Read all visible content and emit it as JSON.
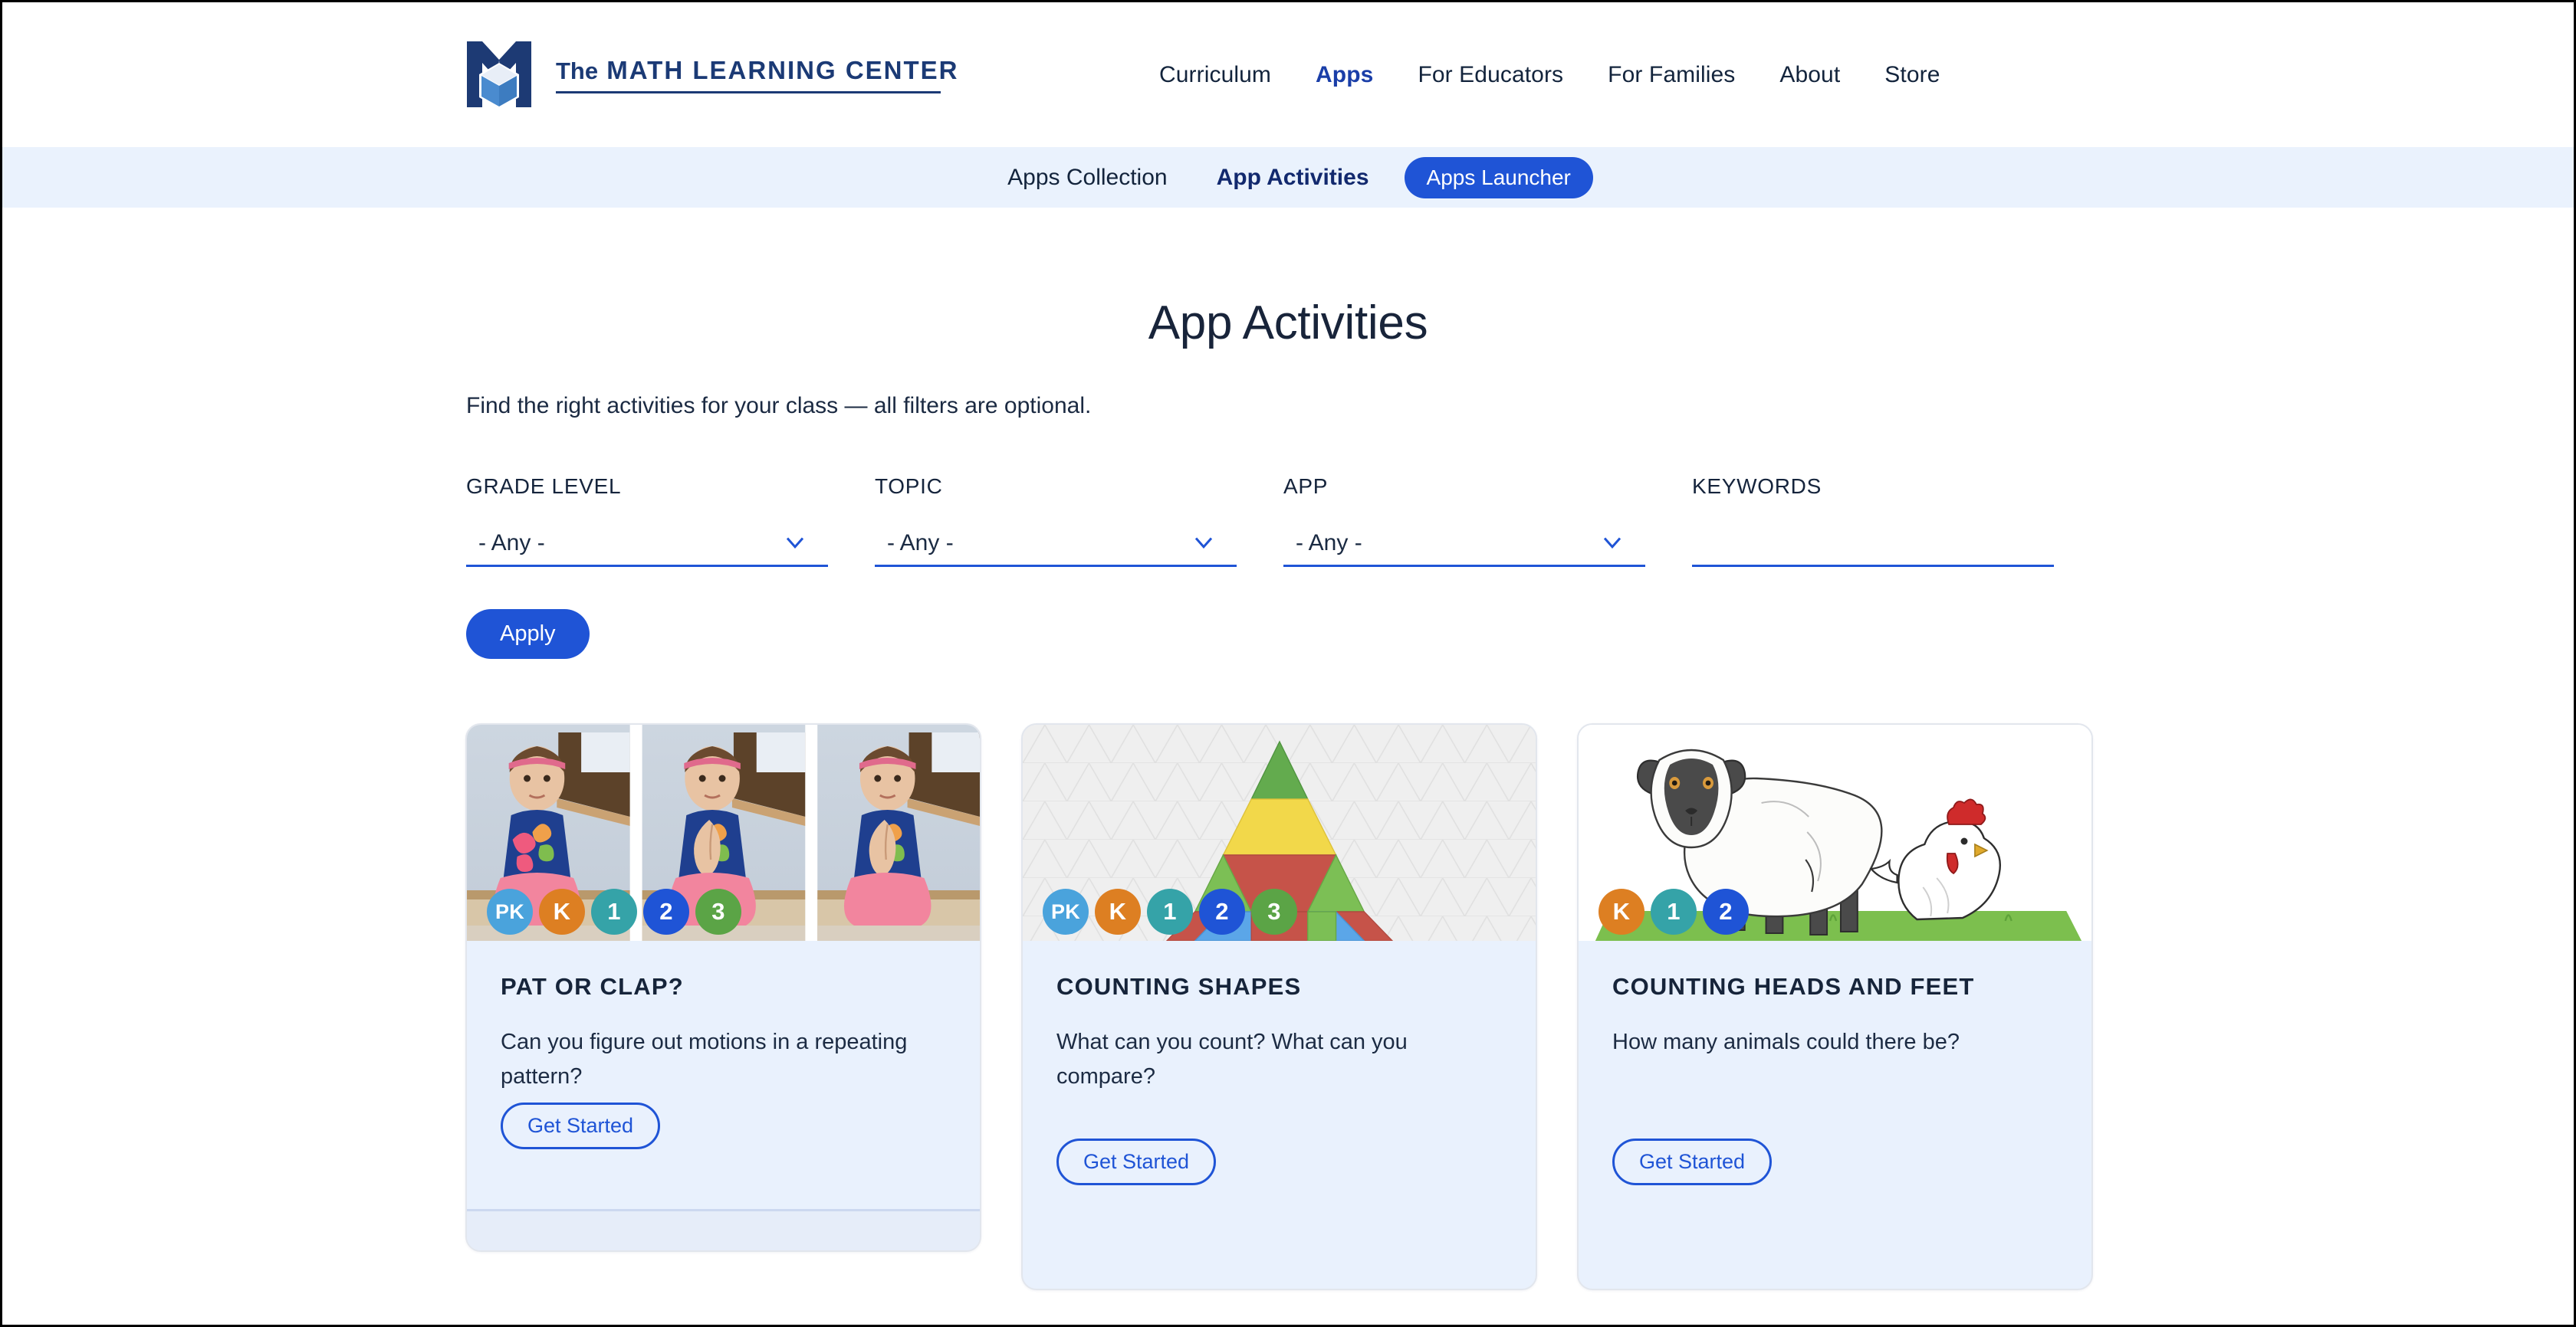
{
  "header": {
    "brand": {
      "the": "The",
      "name": "MATH LEARNING CENTER",
      "logo_icon": "mlc-m-cube-logo"
    },
    "nav": [
      {
        "label": "Curriculum",
        "active": false
      },
      {
        "label": "Apps",
        "active": true
      },
      {
        "label": "For Educators",
        "active": false
      },
      {
        "label": "For Families",
        "active": false
      },
      {
        "label": "About",
        "active": false
      },
      {
        "label": "Store",
        "active": false
      }
    ]
  },
  "subnav": {
    "items": [
      {
        "label": "Apps Collection",
        "style": "plain"
      },
      {
        "label": "App Activities",
        "style": "current"
      },
      {
        "label": "Apps Launcher",
        "style": "pill"
      }
    ]
  },
  "main": {
    "title": "App Activities",
    "intro": "Find the right activities for your class — all filters are optional."
  },
  "filters": {
    "grade_level": {
      "label": "GRADE LEVEL",
      "value": "- Any -",
      "type": "select"
    },
    "topic": {
      "label": "TOPIC",
      "value": "- Any -",
      "type": "select"
    },
    "app": {
      "label": "APP",
      "value": "- Any -",
      "type": "select"
    },
    "keywords": {
      "label": "KEYWORDS",
      "value": "",
      "placeholder": "",
      "type": "text"
    },
    "apply_label": "Apply"
  },
  "grade_colors": {
    "PK": "#4aa3dc",
    "K": "#dd7f22",
    "1": "#35a3a8",
    "2": "#1f54d6",
    "3": "#5ba446"
  },
  "cards": [
    {
      "title": "PAT OR CLAP?",
      "description": "Can you figure out motions in a repeating pattern?",
      "cta": "Get Started",
      "grades": [
        "PK",
        "K",
        "1",
        "2",
        "3"
      ],
      "media": "photo-triptych-child-clapping",
      "height": "short"
    },
    {
      "title": "COUNTING SHAPES",
      "description": "What can you count? What can you compare?",
      "cta": "Get Started",
      "grades": [
        "PK",
        "K",
        "1",
        "2",
        "3"
      ],
      "media": "pattern-blocks-triangle",
      "height": "tall"
    },
    {
      "title": "COUNTING HEADS AND FEET",
      "description": "How many animals could there be?",
      "cta": "Get Started",
      "grades": [
        "K",
        "1",
        "2"
      ],
      "media": "sheep-and-chicken",
      "height": "tall"
    }
  ],
  "colors": {
    "brand_navy": "#1b3a75",
    "accent_blue": "#1f54d6",
    "subnav_bg": "#eaf2fd",
    "card_bg": "#e9f1fd",
    "text_dark": "#16243a"
  }
}
